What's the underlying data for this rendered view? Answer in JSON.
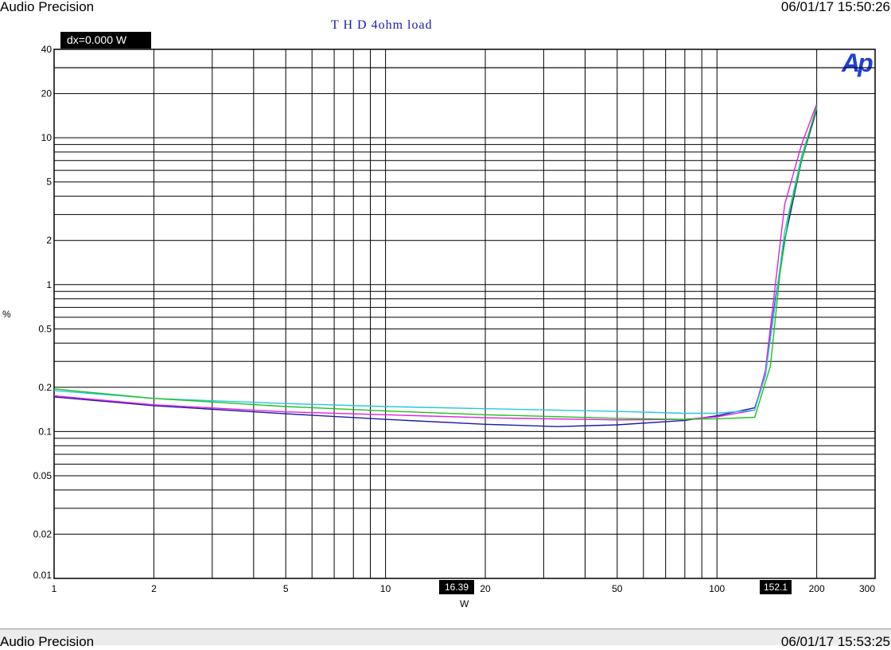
{
  "header": {
    "app_title": "Audio Precision",
    "timestamp": "06/01/17 15:50:26"
  },
  "readout": {
    "dx": "dx=0.000   W"
  },
  "logo_text": "Ap",
  "cursors": {
    "x1": "16.39",
    "x2": "152.1"
  },
  "footer": {
    "app_title": "Audio Precision",
    "timestamp": "06/01/17 15:53:25"
  },
  "chart_data": {
    "type": "line",
    "title": "T H D  4ohm  load",
    "xlabel": "W",
    "ylabel": "%",
    "x_scale": "log",
    "y_scale": "log",
    "xlim": [
      1,
      300
    ],
    "ylim": [
      0.01,
      40
    ],
    "x_ticks": [
      1,
      2,
      5,
      10,
      20,
      50,
      100,
      200,
      300
    ],
    "x_tick_labels": [
      "1",
      "2",
      "5",
      "10",
      "20",
      "50",
      "100",
      "200",
      "300"
    ],
    "y_ticks": [
      0.01,
      0.02,
      0.05,
      0.1,
      0.2,
      0.5,
      1,
      2,
      5,
      10,
      20,
      40
    ],
    "y_tick_labels": [
      "0.01",
      "0.02",
      "0.05",
      "0.1",
      "0.2",
      "0.5",
      "1",
      "2",
      "5",
      "10",
      "20",
      "40"
    ],
    "grid": true,
    "series": [
      {
        "color": "#1a1aa8",
        "x": [
          1,
          2,
          5,
          10,
          20,
          33,
          50,
          80,
          100,
          130,
          140,
          150,
          160,
          180,
          200
        ],
        "y": [
          0.172,
          0.15,
          0.132,
          0.121,
          0.112,
          0.108,
          0.111,
          0.119,
          0.128,
          0.145,
          0.24,
          0.8,
          2.0,
          7.0,
          15.5
        ]
      },
      {
        "color": "#e020e0",
        "x": [
          1,
          2,
          5,
          10,
          20,
          50,
          80,
          100,
          130,
          140,
          150,
          160,
          180,
          200
        ],
        "y": [
          0.175,
          0.152,
          0.136,
          0.13,
          0.124,
          0.12,
          0.121,
          0.126,
          0.14,
          0.26,
          1.0,
          3.5,
          9.0,
          17.0
        ]
      },
      {
        "color": "#22c8e0",
        "x": [
          1,
          2,
          5,
          10,
          20,
          50,
          80,
          100,
          130,
          140,
          150,
          160,
          180,
          200
        ],
        "y": [
          0.19,
          0.168,
          0.155,
          0.148,
          0.143,
          0.137,
          0.133,
          0.133,
          0.14,
          0.24,
          0.75,
          2.3,
          7.5,
          16.0
        ]
      },
      {
        "color": "#20c020",
        "x": [
          1,
          2,
          5,
          10,
          20,
          50,
          80,
          100,
          130,
          145,
          155,
          165,
          180,
          200
        ],
        "y": [
          0.195,
          0.168,
          0.148,
          0.138,
          0.13,
          0.123,
          0.121,
          0.122,
          0.125,
          0.28,
          1.2,
          3.0,
          7.0,
          16.5
        ]
      }
    ]
  }
}
